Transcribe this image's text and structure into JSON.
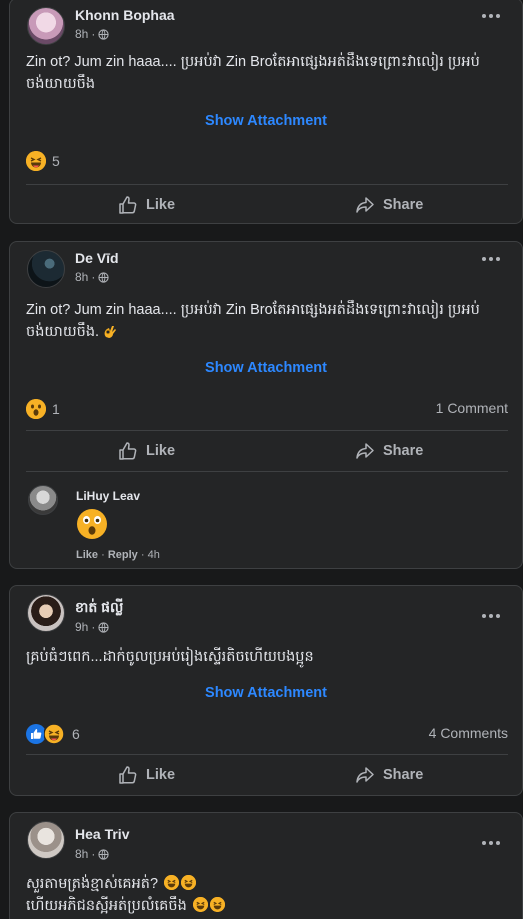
{
  "posts": [
    {
      "author": "Khonn Bophaa",
      "time": "8h",
      "text": "Zin ot? Jum zin haaa.... ប្រអប់វា Zin Broតែអាផ្សេងអត់ដឹងទេព្រោះវាលៀរ ប្រអប់ ចង់យាយចឹង",
      "attachment_label": "Show Attachment",
      "reaction_count": "5",
      "like_label": "Like",
      "share_label": "Share"
    },
    {
      "author": "De Vīd",
      "time": "8h",
      "text": "Zin ot? Jum zin haaa.... ប្រអប់វា Zin Broតែអាផ្សេងអត់ដឹងទេព្រោះវាលៀរ ប្រអប់ ចង់យាយចឹង.",
      "attachment_label": "Show Attachment",
      "reaction_count": "1",
      "comments_count": "1 Comment",
      "like_label": "Like",
      "share_label": "Share",
      "comment": {
        "author": "LiHuy Leav",
        "like": "Like",
        "reply": "Reply",
        "time": "4h"
      }
    },
    {
      "author": "ខាត់ ផល្លី",
      "time": "9h",
      "text": "គ្រប់ធំៗពេក...ដាក់ចូលប្រអប់រៀងស្ទើរតិចហើយបងប្អូន",
      "attachment_label": "Show Attachment",
      "reaction_count": "6",
      "comments_count": "4 Comments",
      "like_label": "Like",
      "share_label": "Share"
    },
    {
      "author": "Hea Triv",
      "time": "8h",
      "text_line1": "សួរតាមត្រង់ខ្មាស់គេអត់?",
      "text_line2": "ហើយអភិជនស្អីអត់ប្រលំគេចឹង"
    }
  ],
  "colors": {
    "background": "#18191a",
    "card": "#242526",
    "link": "#2d88ff",
    "muted": "#b0b3b8"
  }
}
